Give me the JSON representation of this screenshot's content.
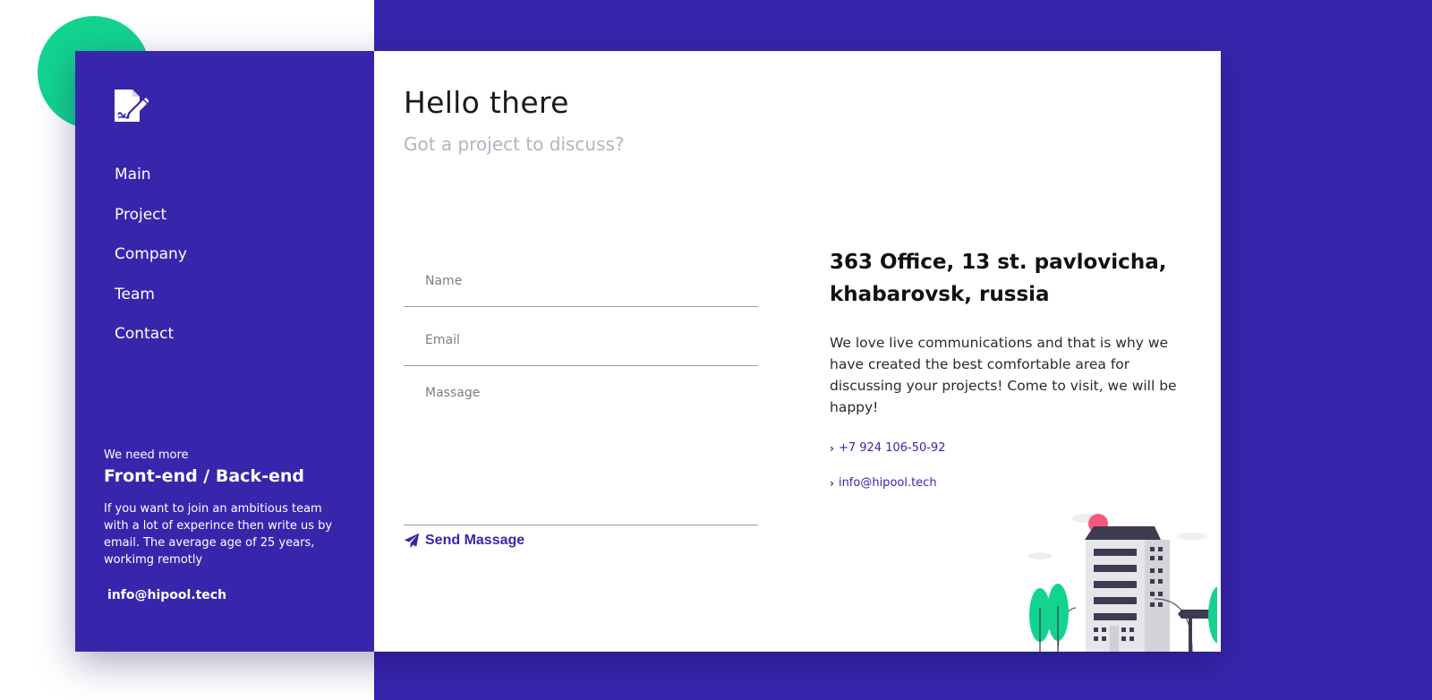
{
  "sidebar": {
    "logo_icon": "document-signature-icon",
    "nav": [
      "Main",
      "Project",
      "Company",
      "Team",
      "Contact"
    ],
    "hiring": {
      "kicker": "We need more",
      "title": "Front-end / Back-end",
      "text": "If you want to join an ambitious team with a lot of experince then write us by email. The average age of 25 years, workimg remotly",
      "email": "info@hipool.tech"
    }
  },
  "main": {
    "title": "Hello there",
    "subtitle": "Got a project to discuss?",
    "form": {
      "name_placeholder": "Name",
      "email_placeholder": "Email",
      "message_placeholder": "Massage",
      "send_label": "Send Massage",
      "send_icon": "paper-plane-icon"
    },
    "info": {
      "address": "363 Office, 13 st. pavlovicha, khabarovsk, russia",
      "blurb": "We love live communications and that is why we have created the best comfortable area for discussing your projects! Come to visit, we will be happy!",
      "phone": "+7 924 106-50-92",
      "email": "info@hipool.tech"
    }
  },
  "colors": {
    "brand_purple": "#3726ac",
    "accent_green": "#13d48f",
    "building_pink": "#f4597a"
  }
}
